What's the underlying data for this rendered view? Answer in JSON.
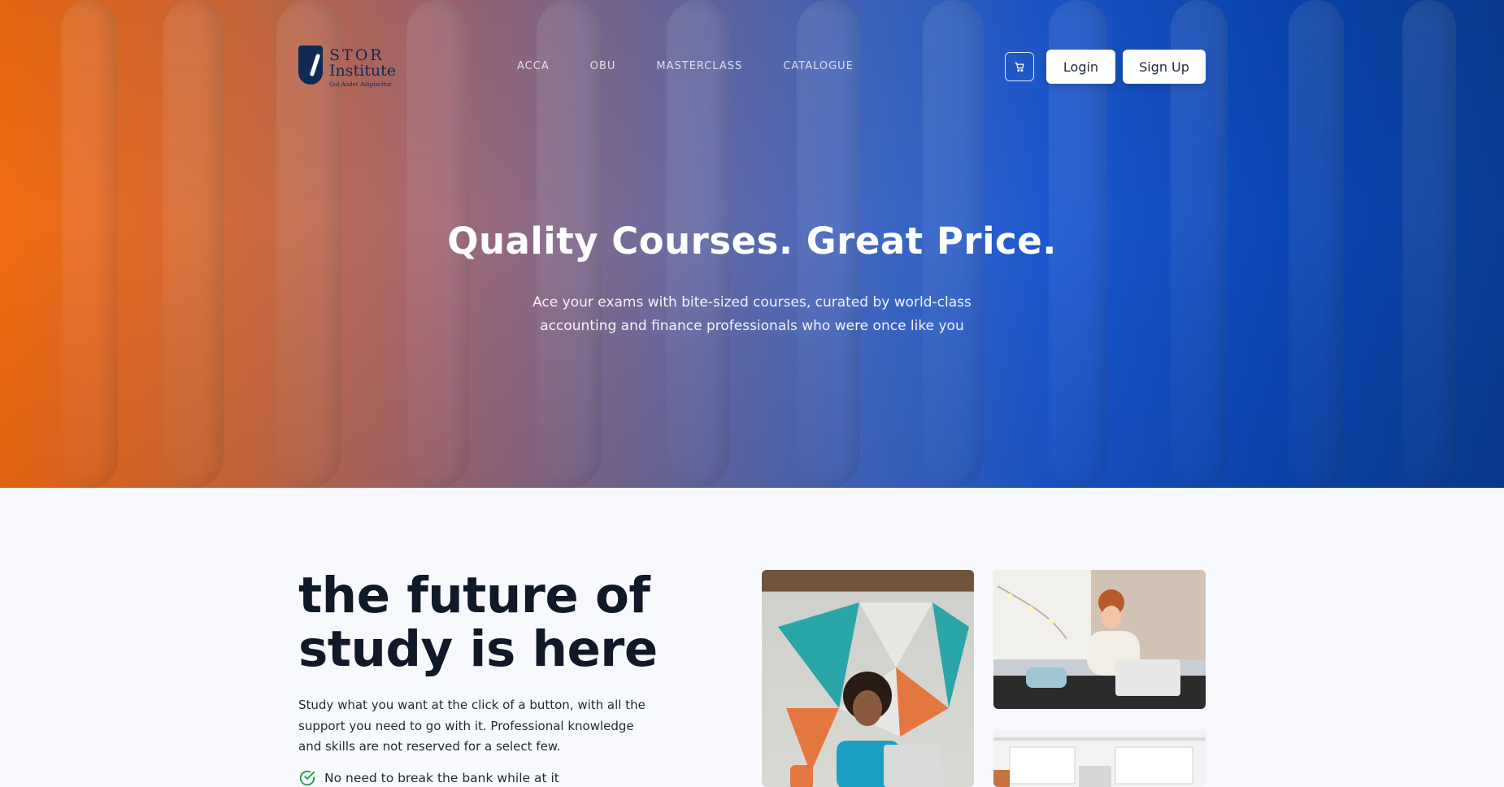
{
  "brand": {
    "line1": "STOR",
    "line2": "Institute",
    "motto": "Qui Audet Adipiscitur"
  },
  "nav": {
    "items": [
      "ACCA",
      "OBU",
      "MASTERCLASS",
      "CATALOGUE"
    ]
  },
  "header": {
    "cart_icon": "cart-icon",
    "login_label": "Login",
    "signup_label": "Sign Up"
  },
  "hero": {
    "title": "Quality Courses. Great Price.",
    "subtitle_line1": "Ace your exams with bite-sized courses, curated by world-class",
    "subtitle_line2": "accounting and finance professionals who were once like you"
  },
  "section": {
    "headline_line1": "the future of",
    "headline_line2": "study is here",
    "body": "Study what you want at the click of a button, with all the support you need to go with it. Professional knowledge and skills are not reserved for a select few.",
    "feature_1": "No need to break the bank while at it"
  },
  "colors": {
    "hero_left": "#f26b12",
    "hero_right": "#0a3b95",
    "brand_navy": "#0f2a55",
    "check_green": "#16a34a"
  }
}
